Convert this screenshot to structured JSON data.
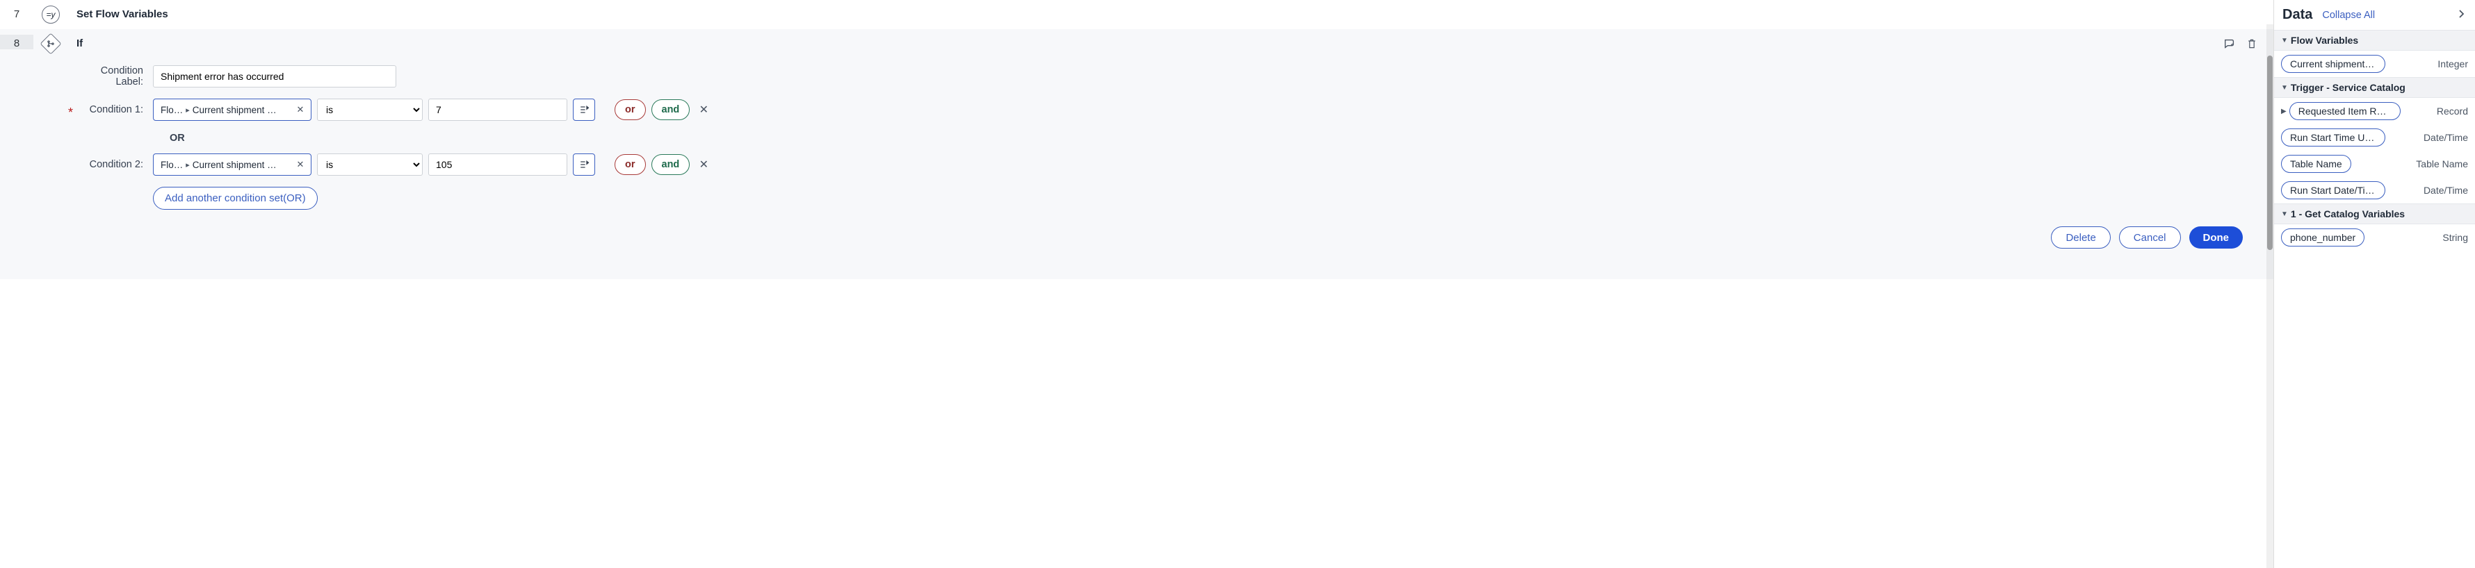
{
  "steps": [
    {
      "num": "7",
      "icon": "=y",
      "title": "Set Flow Variables"
    },
    {
      "num": "8",
      "icon": "branch",
      "title": "If"
    }
  ],
  "if_block": {
    "label_field": "Condition Label:",
    "label_value": "Shipment error has occurred",
    "conditions": [
      {
        "label": "Condition 1:",
        "required": true,
        "field_prefix": "Flo…",
        "field_path": "Current shipment …",
        "op": "is",
        "value": "7",
        "ops": [
          "is"
        ]
      },
      {
        "label": "Condition 2:",
        "required": false,
        "field_prefix": "Flo…",
        "field_path": "Current shipment …",
        "op": "is",
        "value": "105",
        "ops": [
          "is"
        ]
      }
    ],
    "between_op": "OR",
    "buttons": {
      "or": "or",
      "and": "and",
      "add_set": "Add another condition set(OR)",
      "delete": "Delete",
      "cancel": "Cancel",
      "done": "Done"
    }
  },
  "right_panel": {
    "title": "Data",
    "collapse": "Collapse All",
    "sections": [
      {
        "name": "Flow Variables",
        "expanded": true,
        "items": [
          {
            "label": "Current shipment …",
            "type": "Integer",
            "expandable": false
          }
        ]
      },
      {
        "name": "Trigger - Service Catalog",
        "expanded": true,
        "items": [
          {
            "label": "Requested Item Record",
            "type": "Record",
            "expandable": true
          },
          {
            "label": "Run Start Time UTC",
            "type": "Date/Time",
            "expandable": false
          },
          {
            "label": "Table Name",
            "type": "Table Name",
            "expandable": false
          },
          {
            "label": "Run Start Date/Time",
            "type": "Date/Time",
            "expandable": false
          }
        ]
      },
      {
        "name": "1 - Get Catalog Variables",
        "expanded": true,
        "items": [
          {
            "label": "phone_number",
            "type": "String",
            "expandable": false
          }
        ]
      }
    ]
  }
}
